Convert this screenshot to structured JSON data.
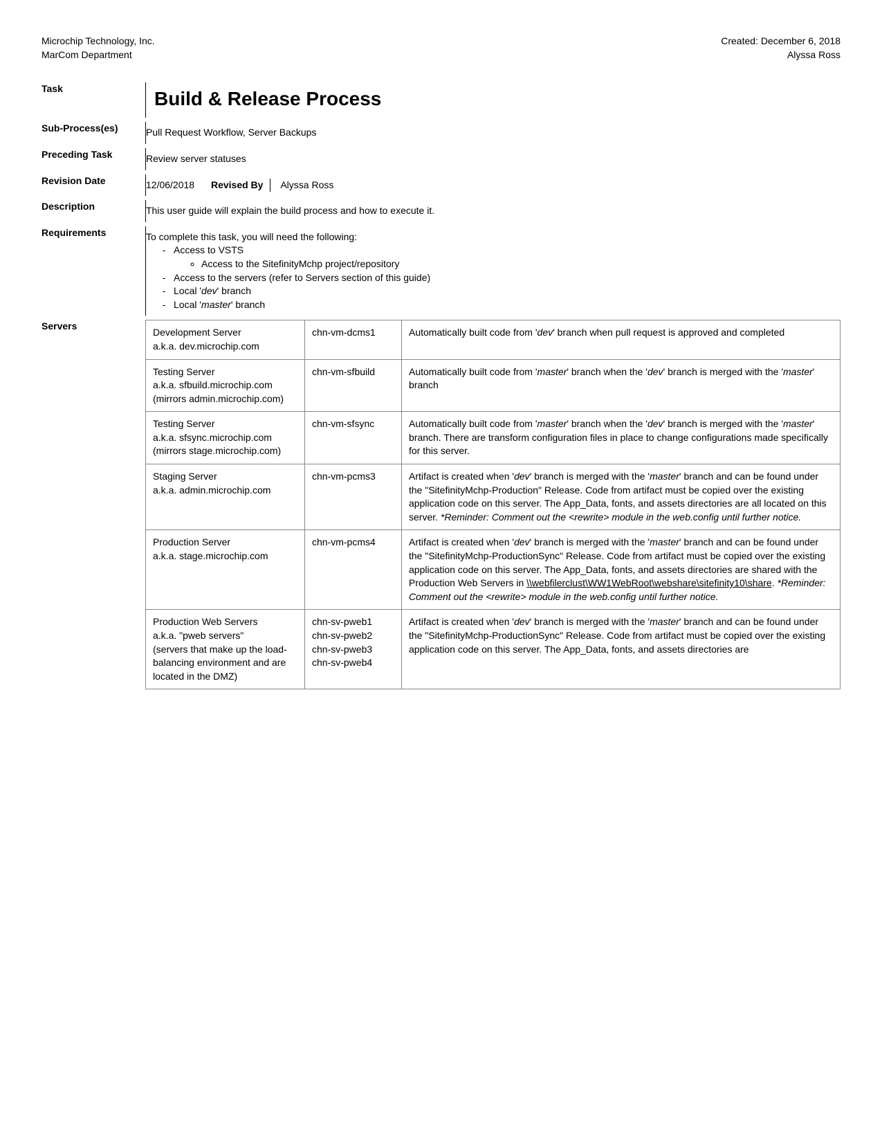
{
  "header": {
    "company": "Microchip Technology, Inc.",
    "dept": "MarCom Department",
    "created": "Created: December 6, 2018",
    "author": "Alyssa Ross"
  },
  "labels": {
    "task": "Task",
    "subprocess": "Sub-Process(es)",
    "preceding": "Preceding Task",
    "revision_date": "Revision Date",
    "revised_by": "Revised By",
    "description": "Description",
    "requirements": "Requirements",
    "servers": "Servers"
  },
  "title": "Build & Release Process",
  "subprocess": "Pull Request Workflow, Server Backups",
  "preceding": "Review server statuses",
  "revision_date": "12/06/2018",
  "revised_by": "Alyssa Ross",
  "description": "This user guide will explain the build process and how to execute it.",
  "requirements": {
    "intro": "To complete this task, you will need the following:",
    "items": {
      "vsts": "Access to VSTS",
      "vsts_sub": "Access to the SitefinityMchp project/repository",
      "servers_access": "Access to the servers (refer to Servers section of this guide)",
      "local_dev_pre": "Local '",
      "local_dev_branch": "dev",
      "local_dev_post": "' branch",
      "local_master_pre": "Local '",
      "local_master_branch": "master",
      "local_master_post": "' branch"
    }
  },
  "servers": [
    {
      "name": "Development Server",
      "aka": "a.k.a. dev.microchip.com",
      "note": "",
      "host": "chn-vm-dcms1",
      "desc_parts": [
        {
          "t": "Automatically built code from '"
        },
        {
          "t": "dev",
          "i": true
        },
        {
          "t": "' branch when pull request is approved and completed"
        }
      ]
    },
    {
      "name": "Testing Server",
      "aka": "a.k.a. sfbuild.microchip.com",
      "note": "(mirrors admin.microchip.com)",
      "host": "chn-vm-sfbuild",
      "desc_parts": [
        {
          "t": "Automatically built code from '"
        },
        {
          "t": "master",
          "i": true
        },
        {
          "t": "' branch when the '"
        },
        {
          "t": "dev",
          "i": true
        },
        {
          "t": "' branch is merged with the '"
        },
        {
          "t": "master",
          "i": true
        },
        {
          "t": "' branch"
        }
      ]
    },
    {
      "name": "Testing Server",
      "aka": "a.k.a. sfsync.microchip.com",
      "note": "(mirrors stage.microchip.com)",
      "host": "chn-vm-sfsync",
      "desc_parts": [
        {
          "t": "Automatically built code from '"
        },
        {
          "t": "master",
          "i": true
        },
        {
          "t": "' branch when the '"
        },
        {
          "t": "dev",
          "i": true
        },
        {
          "t": "' branch is merged with the '"
        },
        {
          "t": "master",
          "i": true
        },
        {
          "t": "' branch. There are transform configuration files in place to change configurations made specifically for this server."
        }
      ]
    },
    {
      "name": "Staging Server",
      "aka": "a.k.a. admin.microchip.com",
      "note": "",
      "host": "chn-vm-pcms3",
      "desc_parts": [
        {
          "t": "Artifact is created when '"
        },
        {
          "t": "dev",
          "i": true
        },
        {
          "t": "' branch is merged with the '"
        },
        {
          "t": "master",
          "i": true
        },
        {
          "t": "' branch and can be found under the \"SitefinityMchp-Production\" Release. Code from artifact must be copied over the existing application code on this server. The App_Data, fonts, and assets directories are all located on this server. "
        },
        {
          "t": "*Reminder: Comment out the <rewrite> module in the web.config until further notice.",
          "i": true
        }
      ]
    },
    {
      "name": "Production Server",
      "aka": "a.k.a. stage.microchip.com",
      "note": "",
      "host": "chn-vm-pcms4",
      "desc_parts": [
        {
          "t": "Artifact is created when '"
        },
        {
          "t": "dev",
          "i": true
        },
        {
          "t": "' branch is merged with the '"
        },
        {
          "t": "master",
          "i": true
        },
        {
          "t": "' branch and can be found under the \"SitefinityMchp-ProductionSync\" Release. Code from artifact must be copied over the existing application code on this server. The App_Data, fonts, and assets directories are shared with the Production Web Servers in "
        },
        {
          "t": "\\\\webfilerclust\\WW1WebRoot\\webshare\\sitefinity10\\share",
          "u": true
        },
        {
          "t": ". "
        },
        {
          "t": "*Reminder: Comment out the <rewrite> module in the web.config until further notice.",
          "i": true
        }
      ]
    },
    {
      "name": "Production Web Servers",
      "aka": "a.k.a. \"pweb servers\"",
      "note": "(servers that make up the load-balancing environment and are located in the DMZ)",
      "host": "chn-sv-pweb1\nchn-sv-pweb2\nchn-sv-pweb3\nchn-sv-pweb4",
      "desc_parts": [
        {
          "t": "Artifact is created when '"
        },
        {
          "t": "dev",
          "i": true
        },
        {
          "t": "' branch is merged with the '"
        },
        {
          "t": "master",
          "i": true
        },
        {
          "t": "' branch and can be found under the \"SitefinityMchp-ProductionSync\" Release. Code from artifact must be copied over the existing application code on this server. The App_Data, fonts, and assets directories are"
        }
      ]
    }
  ]
}
